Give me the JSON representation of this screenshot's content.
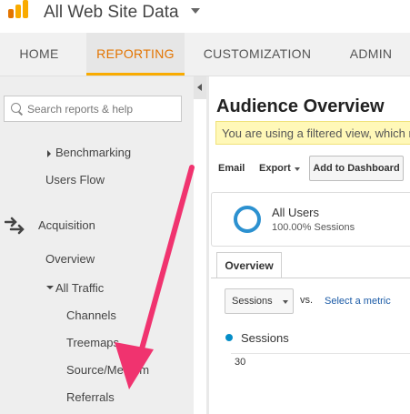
{
  "header": {
    "account_title": "All Web Site Data"
  },
  "nav": {
    "tabs": [
      {
        "label": "HOME"
      },
      {
        "label": "REPORTING"
      },
      {
        "label": "CUSTOMIZATION"
      },
      {
        "label": "ADMIN"
      }
    ],
    "active": "REPORTING",
    "accent_color": "#e37400"
  },
  "sidebar": {
    "search_placeholder": "Search reports & help",
    "benchmarking": "Benchmarking",
    "users_flow": "Users Flow",
    "acquisition": "Acquisition",
    "overview": "Overview",
    "all_traffic": "All Traffic",
    "channels": "Channels",
    "treemaps": "Treemaps",
    "source_medium": "Source/Medium",
    "referrals": "Referrals"
  },
  "main": {
    "title": "Audience Overview",
    "notice": "You are using a filtered view, which m",
    "toolbar": {
      "email": "Email",
      "export": "Export",
      "add_to_dashboard": "Add to Dashboard"
    },
    "segment": {
      "name": "All Users",
      "sub": "100.00% Sessions"
    },
    "tab_overview": "Overview",
    "metric_select": "Sessions",
    "vs": "vs.",
    "select_metric": "Select a metric",
    "legend": "Sessions",
    "y_tick": "30"
  },
  "annotation": {
    "arrow_color": "#f0336f"
  }
}
